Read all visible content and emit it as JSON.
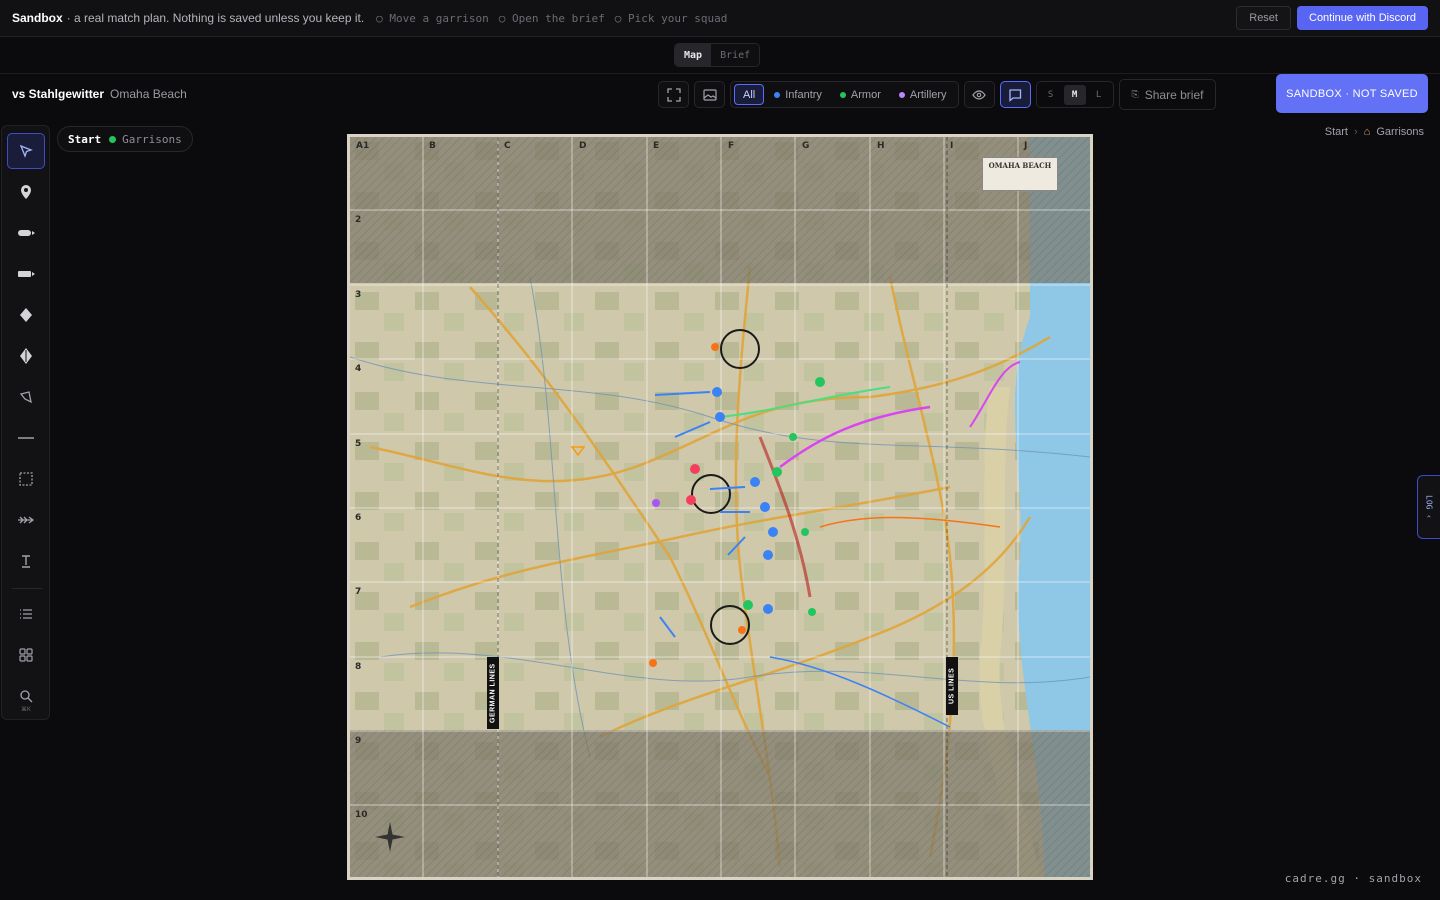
{
  "banner": {
    "brand": "Sandbox",
    "description": "· a real match plan. Nothing is saved unless you keep it.",
    "steps": [
      "Move a garrison",
      "Open the brief",
      "Pick your squad"
    ],
    "reset_label": "Reset",
    "discord_label": "Continue with Discord"
  },
  "view_tabs": [
    {
      "label": "Map",
      "active": true
    },
    {
      "label": "Brief",
      "active": false
    }
  ],
  "match": {
    "title": "vs Stahlgewitter",
    "map": "Omaha Beach"
  },
  "filters": [
    {
      "label": "All",
      "active": true
    },
    {
      "label": "Infantry",
      "color": "#3b82f6"
    },
    {
      "label": "Armor",
      "color": "#22c55e"
    },
    {
      "label": "Artillery",
      "color": "#c084fc"
    }
  ],
  "sizes": [
    {
      "label": "S"
    },
    {
      "label": "M",
      "active": true
    },
    {
      "label": "L"
    }
  ],
  "share_label": "Share brief",
  "sandbox_badge": "SANDBOX · NOT SAVED",
  "phase_chip": {
    "start": "Start",
    "garrisons": "Garrisons",
    "dot_color": "#22c55e"
  },
  "breadcrumb": {
    "start": "Start",
    "sep": "›",
    "current": "Garrisons"
  },
  "tools": [
    {
      "icon": "pointer-icon"
    },
    {
      "icon": "garrison-pin-icon"
    },
    {
      "icon": "infantry-unit-icon"
    },
    {
      "icon": "armor-unit-icon"
    },
    {
      "icon": "artillery-icon"
    },
    {
      "icon": "strongpoint-icon"
    },
    {
      "icon": "polygon-icon"
    },
    {
      "icon": "line-icon"
    },
    {
      "icon": "area-select-icon"
    },
    {
      "icon": "arrow-path-icon"
    },
    {
      "icon": "text-icon"
    },
    {
      "icon": "list-icon"
    },
    {
      "icon": "grid-icon"
    },
    {
      "icon": "search-icon",
      "hotkey": "⌘K"
    }
  ],
  "map": {
    "columns": [
      "A1",
      "B",
      "C",
      "D",
      "E",
      "F",
      "G",
      "H",
      "I",
      "J"
    ],
    "rows": [
      "2",
      "3",
      "4",
      "5",
      "6",
      "7",
      "8",
      "9",
      "10"
    ],
    "card_title": "OMAHA BEACH",
    "german_lines": "GERMAN LINES",
    "us_lines": "US LINES"
  },
  "log_label": "LOG",
  "footer": "cadre.gg · sandbox"
}
